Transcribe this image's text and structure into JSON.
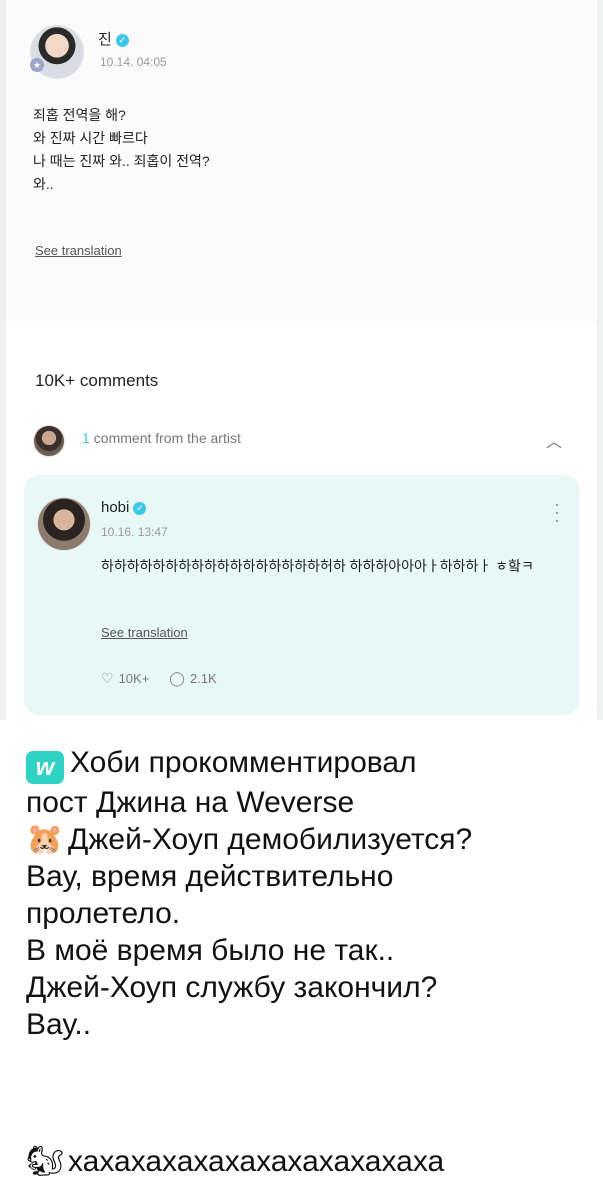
{
  "post": {
    "author": "진",
    "time": "10.14. 04:05",
    "body": "죄홉 전역을 해?\n와 진짜 시간 빠르다\n나 때는 진짜 와.. 죄홉이 전역?\n와..",
    "see_translation": "See translation"
  },
  "comments": {
    "count_label": "10K+ comments",
    "artist_count": "1",
    "artist_label": "comment from the artist"
  },
  "artist_comment": {
    "author": "hobi",
    "time": "10.16. 13:47",
    "text": "하하하하하하하하하하하하하하하하하허하 하하하아아아ㅏ하하하ㅏ ㅎ핰ㅋ",
    "see_translation": "See translation",
    "likes": "10K+",
    "replies": "2.1K"
  },
  "message": {
    "lines": [
      "Хоби прокомментировал",
      "пост Джина на Weverse",
      "Джей-Хоуп демобилизуется?",
      "Вау, время действительно",
      "пролетело.",
      "В моё время было не так..",
      "Джей-Хоуп службу закончил?",
      "Вау.."
    ],
    "laugh": "хахахахахахахахахахахаха",
    "hamster_emoji": "🐹",
    "squirrel_emoji": "🐿"
  },
  "colors": {
    "accent": "#3ec8e6",
    "card_bg": "#e7f8f6",
    "weverse": "#2fd2c5"
  }
}
